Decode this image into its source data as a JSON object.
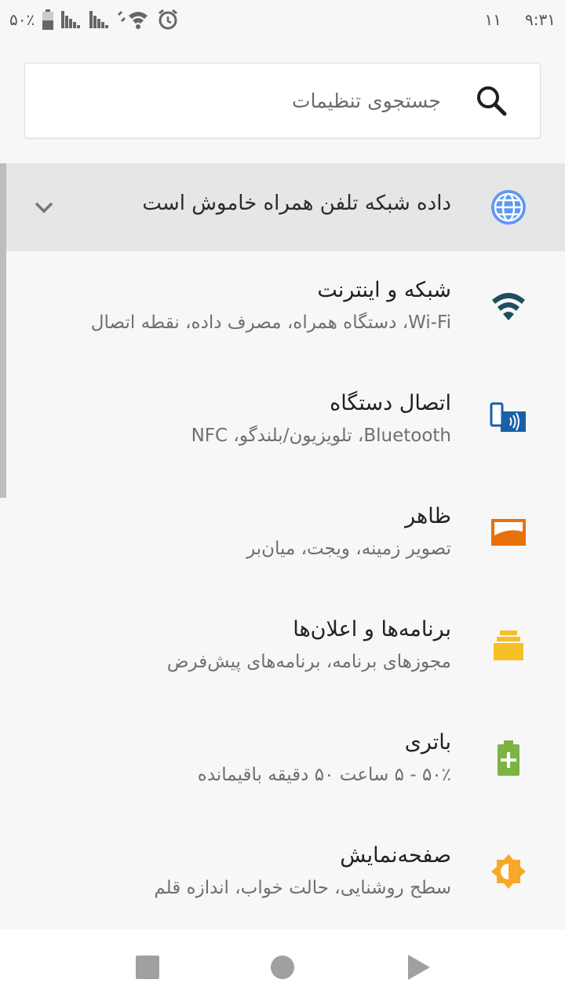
{
  "status_bar": {
    "battery_text": "۵۰٪",
    "time": "۹:۳۱",
    "notification_count": "۱۱"
  },
  "search": {
    "placeholder": "جستجوی تنظیمات",
    "icon": "search-icon"
  },
  "condition": {
    "text": "داده شبکه تلفن همراه خاموش است",
    "icon": "globe-icon",
    "icon_color": "#5e97f6"
  },
  "settings": [
    {
      "title": "شبکه و اینترنت",
      "summary": "Wi-Fi، دستگاه همراه، مصرف داده، نقطه اتصال",
      "icon": "wifi-icon",
      "color": "#1f4e5f"
    },
    {
      "title": "اتصال دستگاه",
      "summary": "Bluetooth، تلویزیون/بلندگو، NFC",
      "icon": "devices-icon",
      "color": "#1a5fa8"
    },
    {
      "title": "ظاهر",
      "summary": "تصویر زمینه، ویجت، میان‌بر",
      "icon": "display-icon",
      "color": "#e8710a"
    },
    {
      "title": "برنامه‌ها و اعلان‌ها",
      "summary": "مجوزهای برنامه، برنامه‌های پیش‌فرض",
      "icon": "apps-icon",
      "color": "#f6bf26"
    },
    {
      "title": "باتری",
      "summary": "۵۰٪ - ۵ ساعت  ۵۰ دقیقه باقیمانده",
      "icon": "battery-icon",
      "color": "#7cb342"
    },
    {
      "title": "صفحه‌نمایش",
      "summary": "سطح روشنایی، حالت خواب، اندازه قلم",
      "icon": "brightness-icon",
      "color": "#f9a825"
    }
  ],
  "navigation": {
    "recents": "recents-icon",
    "home": "home-icon",
    "back": "back-icon"
  }
}
